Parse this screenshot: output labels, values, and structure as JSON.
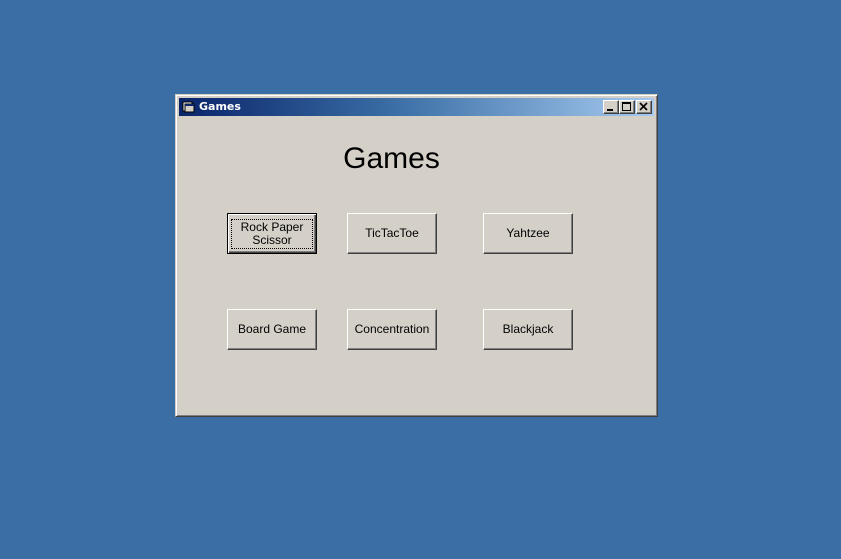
{
  "window": {
    "title": "Games",
    "controls": {
      "minimize": "minimize-icon",
      "maximize": "maximize-icon",
      "close": "close-icon"
    }
  },
  "main": {
    "heading": "Games",
    "buttons": [
      {
        "label": "Rock Paper\nScissor",
        "focused": true
      },
      {
        "label": "TicTacToe"
      },
      {
        "label": "Yahtzee"
      },
      {
        "label": "Board Game"
      },
      {
        "label": "Concentration"
      },
      {
        "label": "Blackjack"
      }
    ]
  },
  "colors": {
    "desktop": "#3a6ea5",
    "window_face": "#d4d0c8",
    "titlebar_start": "#0a246a",
    "titlebar_end": "#a6caf0"
  }
}
